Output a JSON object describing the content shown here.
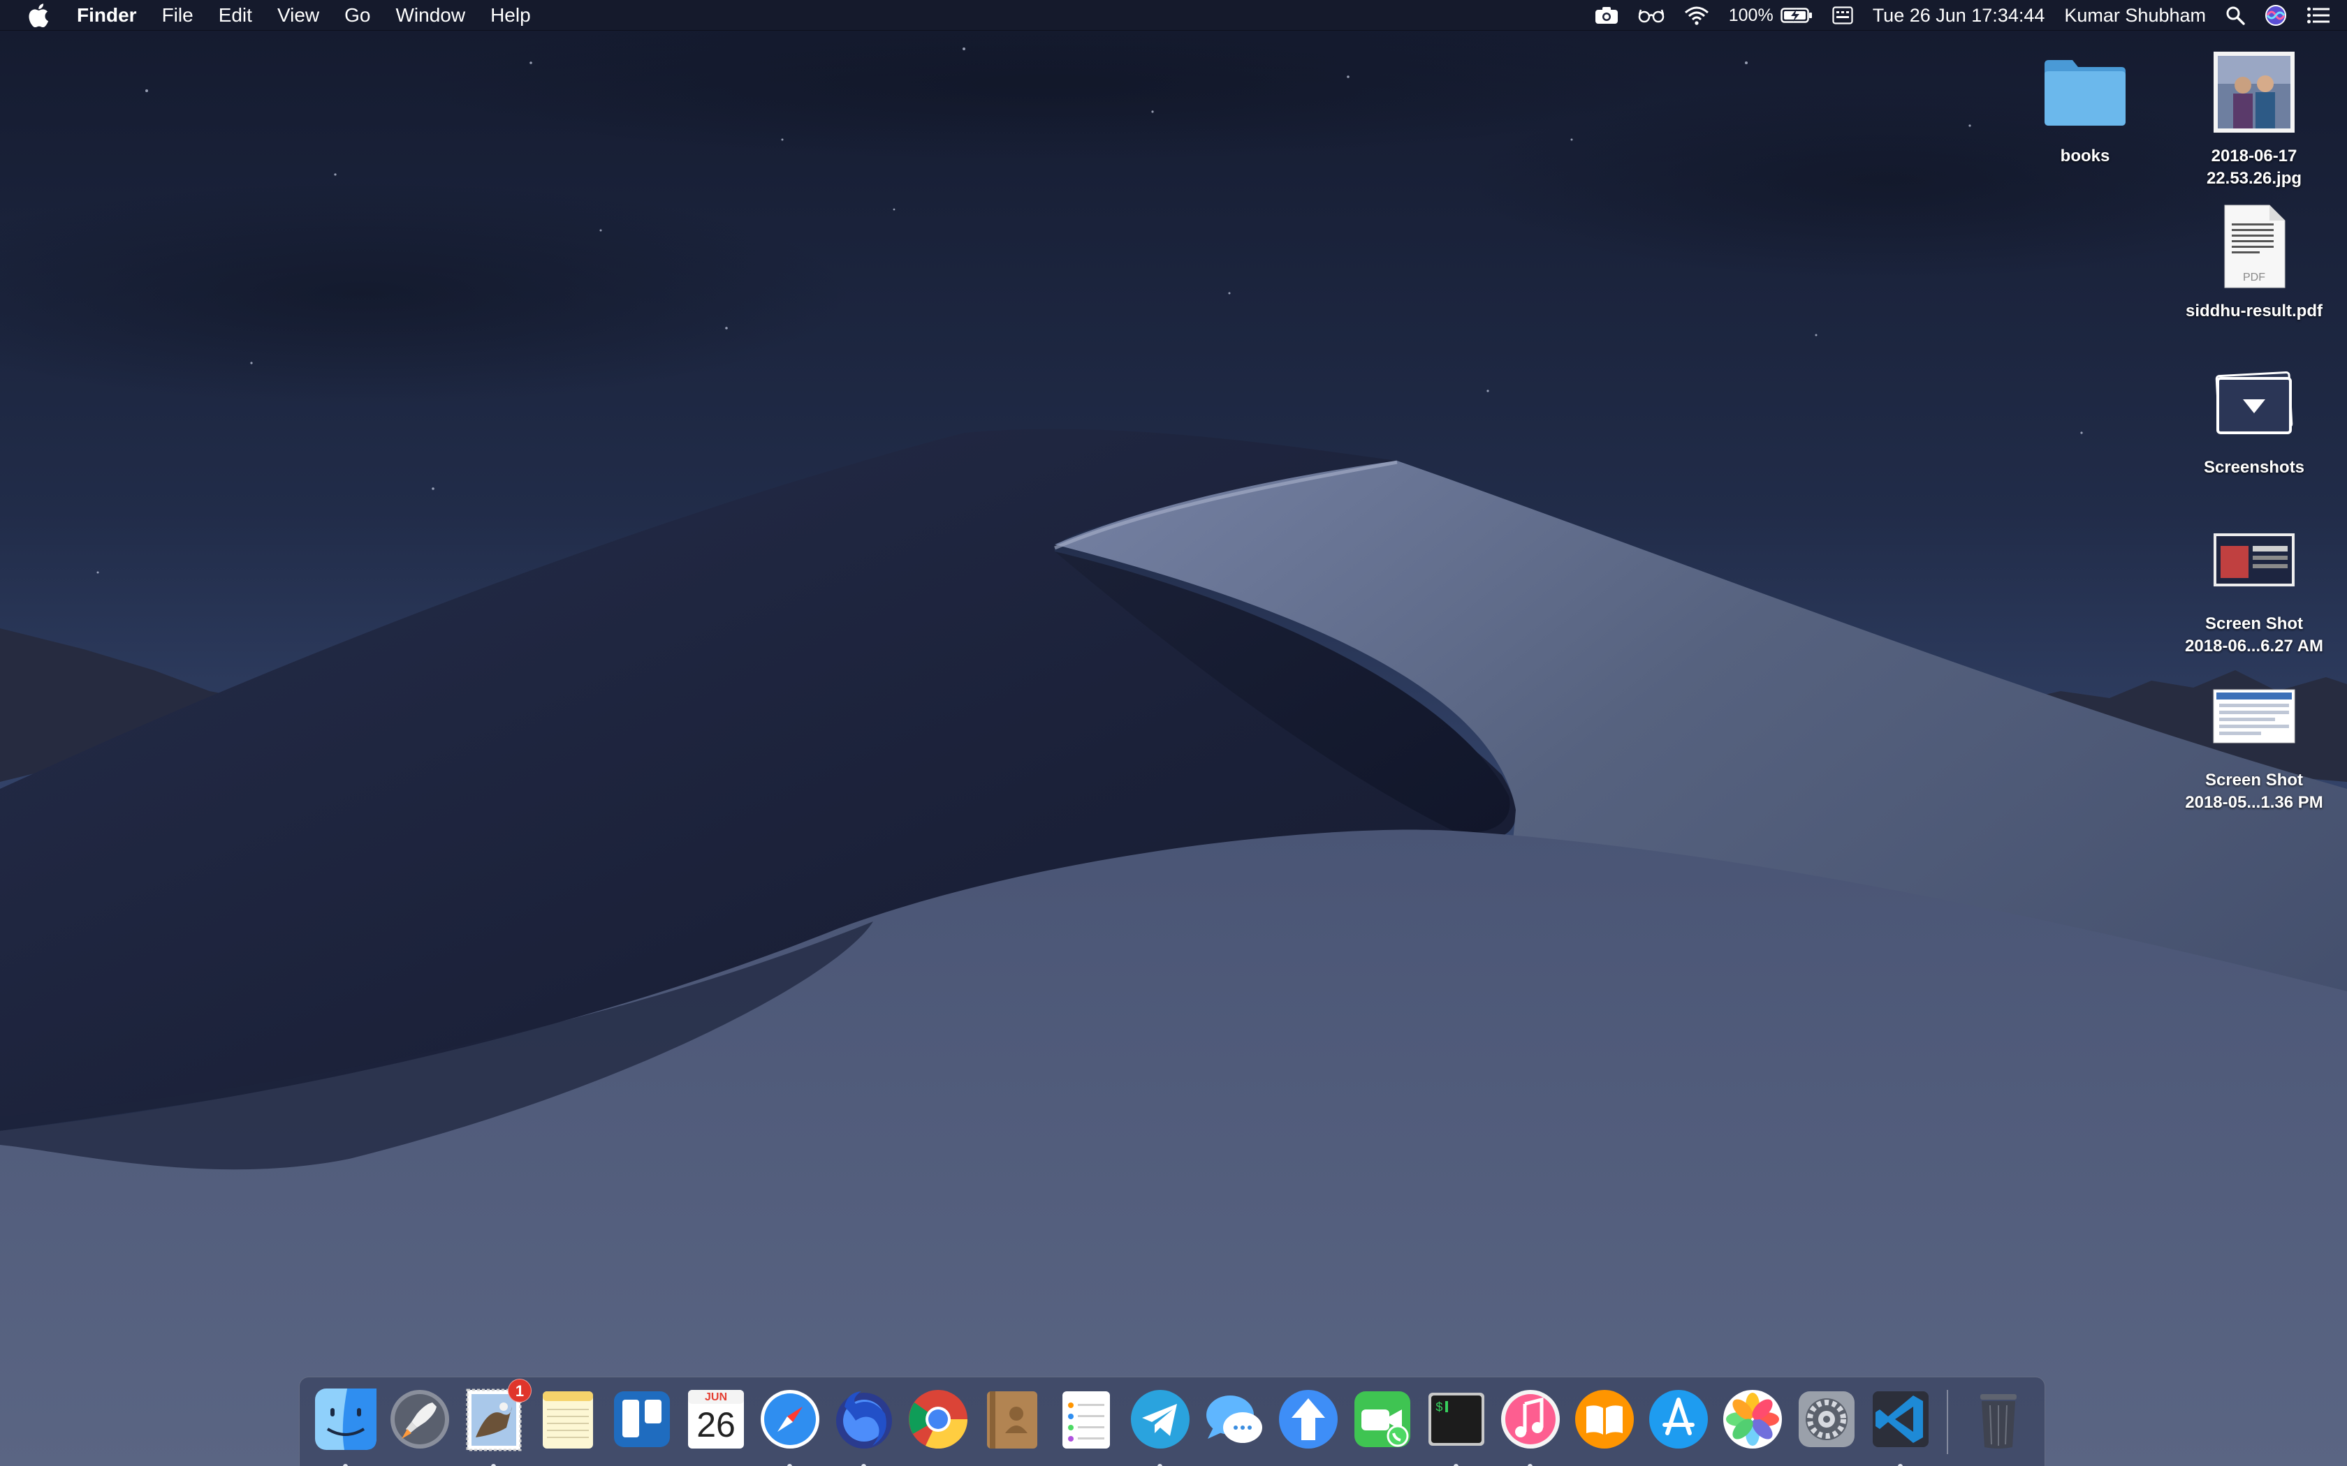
{
  "menubar": {
    "apple_icon": "apple-logo",
    "app_name": "Finder",
    "menus": [
      "File",
      "Edit",
      "View",
      "Go",
      "Window",
      "Help"
    ],
    "status": {
      "battery_percent": "100%",
      "datetime": "Tue 26 Jun  17:34:44",
      "user": "Kumar Shubham"
    }
  },
  "desktop": {
    "icons": [
      {
        "name": "books",
        "kind": "folder"
      },
      {
        "name_line1": "2018-06-17",
        "name_line2": "22.53.26.jpg",
        "kind": "photo"
      },
      {
        "name": "siddhu-result.pdf",
        "kind": "pdf",
        "pdf_tag": "PDF"
      },
      {
        "name": "Screenshots",
        "kind": "stack"
      },
      {
        "name_line1": "Screen Shot",
        "name_line2": "2018-06...6.27 AM",
        "kind": "screenshot"
      },
      {
        "name_line1": "Screen Shot",
        "name_line2": "2018-05...1.36 PM",
        "kind": "screenshot"
      }
    ]
  },
  "dock": {
    "mail_badge": "1",
    "calendar_month": "JUN",
    "calendar_day": "26",
    "apps": [
      "finder",
      "launchpad",
      "mail",
      "notes",
      "trello",
      "calendar",
      "safari",
      "firefox",
      "chrome",
      "contacts",
      "reminders",
      "telegram",
      "messages",
      "transloader",
      "facetime",
      "terminal",
      "itunes",
      "ibooks",
      "app-store",
      "photos",
      "system-preferences",
      "visual-studio-code",
      "trash"
    ]
  },
  "colors": {
    "menubar_bg": "#161b2c",
    "sky_top": "#161d33",
    "dune_shadow": "#1b2138",
    "dune_light": "#5a6688",
    "mail_badge": "#e0352b",
    "folder_blue": "#5fb0e6"
  }
}
